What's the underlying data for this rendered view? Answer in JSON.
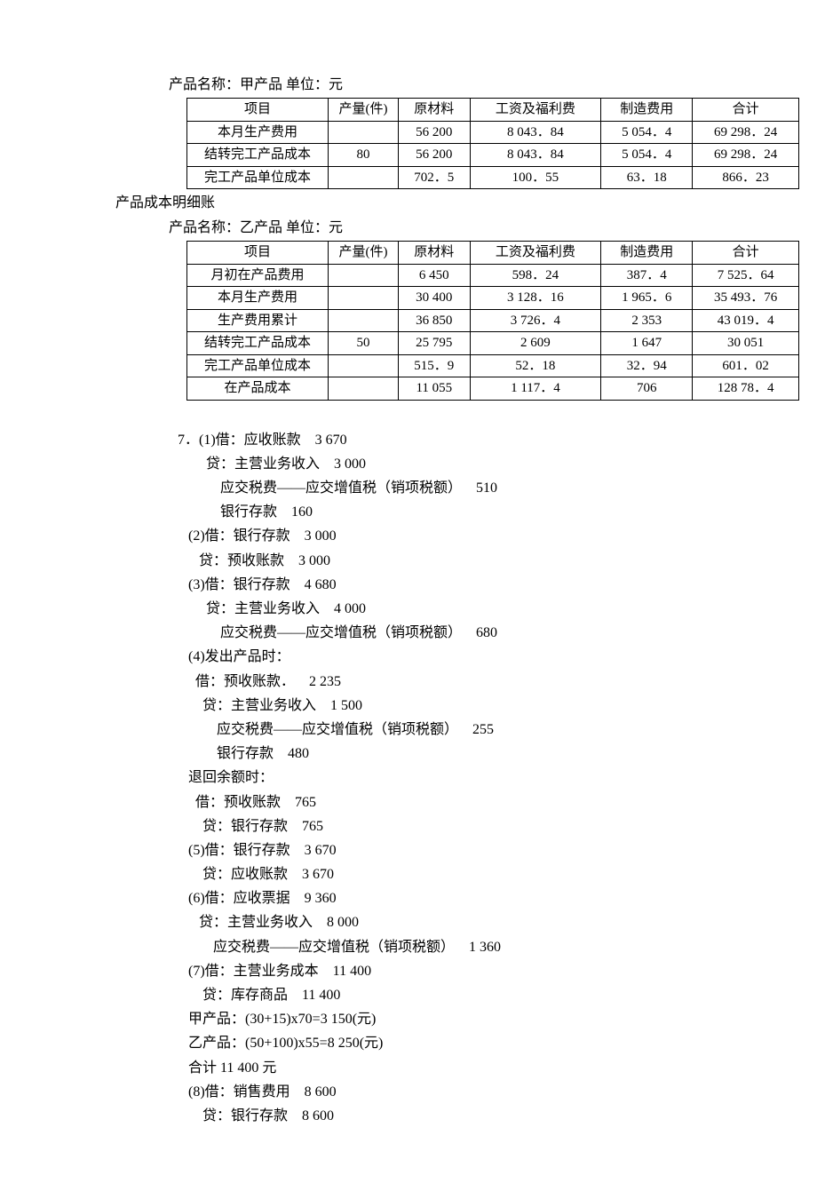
{
  "table1_title": "产品名称：甲产品    单位：元",
  "table1": {
    "headers": [
      "项目",
      "产量(件)",
      "原材料",
      "工资及福利费",
      "制造费用",
      "合计"
    ],
    "rows": [
      [
        "本月生产费用",
        "",
        "56 200",
        "8 043．84",
        "5 054．4",
        "69 298．24"
      ],
      [
        "结转完工产品成本",
        "80",
        "56 200",
        "8 043．84",
        "5 054．4",
        "69 298．24"
      ],
      [
        "完工产品单位成本",
        "",
        "702．5",
        "100．55",
        "63．18",
        "866．23"
      ]
    ]
  },
  "subtitle": "产品成本明细账",
  "table2_title": "产品名称：乙产品    单位：元",
  "table2": {
    "headers": [
      "项目",
      "产量(件)",
      "原材料",
      "工资及福利费",
      "制造费用",
      "合计"
    ],
    "rows": [
      [
        "月初在产品费用",
        "",
        "6 450",
        "598．24",
        "387．4",
        "7 525．64"
      ],
      [
        "本月生产费用",
        "",
        "30 400",
        "3 128．16",
        "1 965．6",
        "35 493．76"
      ],
      [
        "生产费用累计",
        "",
        "36 850",
        "3 726．4",
        "2 353",
        "43 019．4"
      ],
      [
        "结转完工产品成本",
        "50",
        "25 795",
        "2 609",
        "1 647",
        "30 051"
      ],
      [
        "完工产品单位成本",
        "",
        "515．9",
        "52．18",
        "32．94",
        "601．02"
      ],
      [
        "在产品成本",
        "",
        "11 055",
        "1 117．4",
        "706",
        "128 78．4"
      ]
    ]
  },
  "e": {
    "l01": "7．(1)借：应收账款    3 670",
    "l02": "        贷：主营业务收入    3 000",
    "l03": "            应交税费——应交增值税（销项税额）    510",
    "l04": "            银行存款    160",
    "l05": "   (2)借：银行存款    3 000",
    "l06": "      贷：预收账款    3 000",
    "l07": "   (3)借：银行存款    4 680",
    "l08": "        贷：主营业务收入    4 000",
    "l09": "            应交税费——应交增值税（销项税额）    680",
    "l10": "   (4)发出产品时：",
    "l11": "     借：预收账款．    2 235",
    "l12": "       贷：主营业务收入    1 500",
    "l13": "           应交税费——应交增值税（销项税额）    255",
    "l14": "           银行存款    480",
    "l15": "   退回余额时：",
    "l16": "     借：预收账款    765",
    "l17": "       贷：银行存款    765",
    "l18": "   (5)借：银行存款    3 670",
    "l19": "       贷：应收账款    3 670",
    "l20": "   (6)借：应收票据    9 360",
    "l21": "      贷：主营业务收入    8 000",
    "l22": "          应交税费——应交增值税（销项税额）    1 360",
    "l23": "   (7)借：主营业务成本    11 400",
    "l24": "       贷：库存商品    11 400",
    "l25": "   甲产品：(30+15)x70=3 150(元)",
    "l26": "   乙产品：(50+100)x55=8 250(元)",
    "l27": "   合计 11 400 元",
    "l28": "   (8)借：销售费用    8 600",
    "l29": "       贷：银行存款    8 600"
  }
}
